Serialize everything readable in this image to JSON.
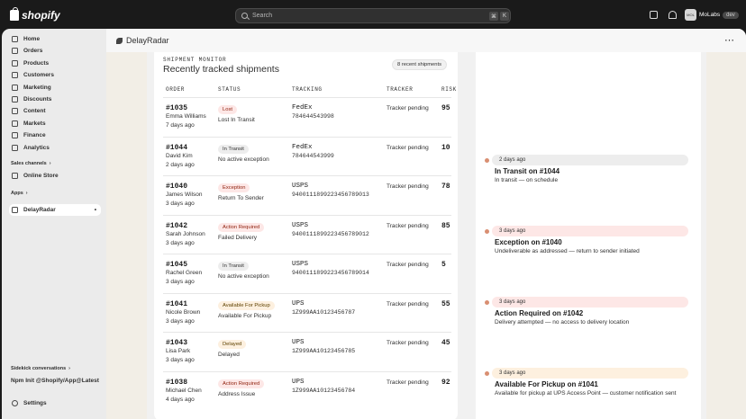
{
  "topbar": {
    "brand": "shopify",
    "search_placeholder": "Search",
    "kbd_cmd": "⌘",
    "kbd_k": "K",
    "user_name": "MoLabs",
    "user_initials": "MOL",
    "env_badge": "dev"
  },
  "sidebar": {
    "items": [
      {
        "label": "Home",
        "icon": "home-icon"
      },
      {
        "label": "Orders",
        "icon": "orders-icon"
      },
      {
        "label": "Products",
        "icon": "tag-icon"
      },
      {
        "label": "Customers",
        "icon": "person-icon"
      },
      {
        "label": "Marketing",
        "icon": "target-icon"
      },
      {
        "label": "Discounts",
        "icon": "discount-icon"
      },
      {
        "label": "Content",
        "icon": "content-icon"
      },
      {
        "label": "Markets",
        "icon": "globe-icon"
      },
      {
        "label": "Finance",
        "icon": "bank-icon"
      },
      {
        "label": "Analytics",
        "icon": "chart-icon"
      }
    ],
    "sales_channels_label": "Sales channels",
    "online_store_label": "Online Store",
    "apps_label": "Apps",
    "app_item_label": "DelayRadar",
    "sidekick_label": "Sidekick conversations",
    "npm_label": "Npm Init @Shopify/App@Latest",
    "settings_label": "Settings"
  },
  "app": {
    "title": "DelayRadar",
    "more": "⋯"
  },
  "monitor": {
    "eyebrow": "SHIPMENT MONITOR",
    "title": "Recently tracked shipments",
    "recent_count": "8 recent shipments",
    "headers": {
      "order": "ORDER",
      "status": "STATUS",
      "tracking": "TRACKING",
      "tracker": "TRACKER",
      "risk": "RISK"
    },
    "rows": [
      {
        "order": "#1035",
        "name": "Emma Williams",
        "date": "7 days ago",
        "status": "Lost",
        "status_detail": "Lost In Transit",
        "carrier": "FedEx",
        "tracking": "784644543998",
        "tracker": "Tracker pending",
        "risk": "95"
      },
      {
        "order": "#1044",
        "name": "David Kim",
        "date": "2 days ago",
        "status": "In Transit",
        "status_detail": "No active exception",
        "carrier": "FedEx",
        "tracking": "784644543999",
        "tracker": "Tracker pending",
        "risk": "10"
      },
      {
        "order": "#1040",
        "name": "James Wilson",
        "date": "3 days ago",
        "status": "Exception",
        "status_detail": "Return To Sender",
        "carrier": "USPS",
        "tracking": "9400111899223456789013",
        "tracker": "Tracker pending",
        "risk": "78"
      },
      {
        "order": "#1042",
        "name": "Sarah Johnson",
        "date": "3 days ago",
        "status": "Action Required",
        "status_detail": "Failed Delivery",
        "carrier": "USPS",
        "tracking": "9400111899223456789012",
        "tracker": "Tracker pending",
        "risk": "85"
      },
      {
        "order": "#1045",
        "name": "Rachel Green",
        "date": "3 days ago",
        "status": "In Transit",
        "status_detail": "No active exception",
        "carrier": "USPS",
        "tracking": "9400111899223456789014",
        "tracker": "Tracker pending",
        "risk": "5"
      },
      {
        "order": "#1041",
        "name": "Nicole Brown",
        "date": "3 days ago",
        "status": "Available For Pickup",
        "status_detail": "Available For Pickup",
        "carrier": "UPS",
        "tracking": "1Z999AA10123456787",
        "tracker": "Tracker pending",
        "risk": "55"
      },
      {
        "order": "#1043",
        "name": "Lisa Park",
        "date": "3 days ago",
        "status": "Delayed",
        "status_detail": "Delayed",
        "carrier": "UPS",
        "tracking": "1Z999AA10123456785",
        "tracker": "Tracker pending",
        "risk": "45"
      },
      {
        "order": "#1038",
        "name": "Michael Chen",
        "date": "4 days ago",
        "status": "Action Required",
        "status_detail": "Address Issue",
        "carrier": "UPS",
        "tracking": "1Z999AA10123456784",
        "tracker": "Tracker pending",
        "risk": "92"
      }
    ]
  },
  "timeline": {
    "events": [
      {
        "time": "2 days ago",
        "title": "In Transit on #1044",
        "detail": "In transit — on schedule",
        "tone": "neutral"
      },
      {
        "time": "3 days ago",
        "title": "Exception on #1040",
        "detail": "Undeliverable as addressed — return to sender initiated",
        "tone": "critical"
      },
      {
        "time": "3 days ago",
        "title": "Action Required on #1042",
        "detail": "Delivery attempted — no access to delivery location",
        "tone": "critical"
      },
      {
        "time": "3 days ago",
        "title": "Available For Pickup on #1041",
        "detail": "Available for pickup at UPS Access Point — customer notification sent",
        "tone": "warning"
      }
    ]
  },
  "colors": {
    "critical_bg": "#fde7e6",
    "critical_fg": "#8e1f0b",
    "warning_bg": "#fdf0df",
    "warning_fg": "#5e4200",
    "neutral_bg": "#ededed",
    "neutral_fg": "#303030",
    "dot": "#d98f72"
  }
}
